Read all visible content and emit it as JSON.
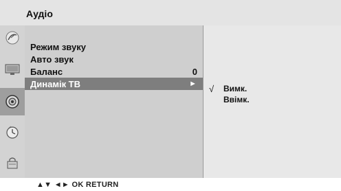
{
  "header": {
    "title": "Аудіо"
  },
  "sidebar": {
    "icons": [
      {
        "name": "satellite-dish-icon",
        "selected": false
      },
      {
        "name": "screen-icon",
        "selected": false
      },
      {
        "name": "speaker-icon",
        "selected": true
      },
      {
        "name": "clock-icon",
        "selected": false
      },
      {
        "name": "lock-icon",
        "selected": false
      }
    ]
  },
  "menu": {
    "items": [
      {
        "label": "Режим звуку",
        "value": ""
      },
      {
        "label": "Авто звук",
        "value": ""
      },
      {
        "label": "Баланс",
        "value": "0"
      },
      {
        "label": "Динамік ТВ",
        "value": "►"
      }
    ],
    "selected_index": 3
  },
  "submenu": {
    "options": [
      {
        "label": "Вимк.",
        "checked": true
      },
      {
        "label": "Ввімк.",
        "checked": false
      }
    ],
    "check_mark": "√"
  },
  "footer": {
    "hint": "▲▼  ◄►  OK  RETURN"
  }
}
